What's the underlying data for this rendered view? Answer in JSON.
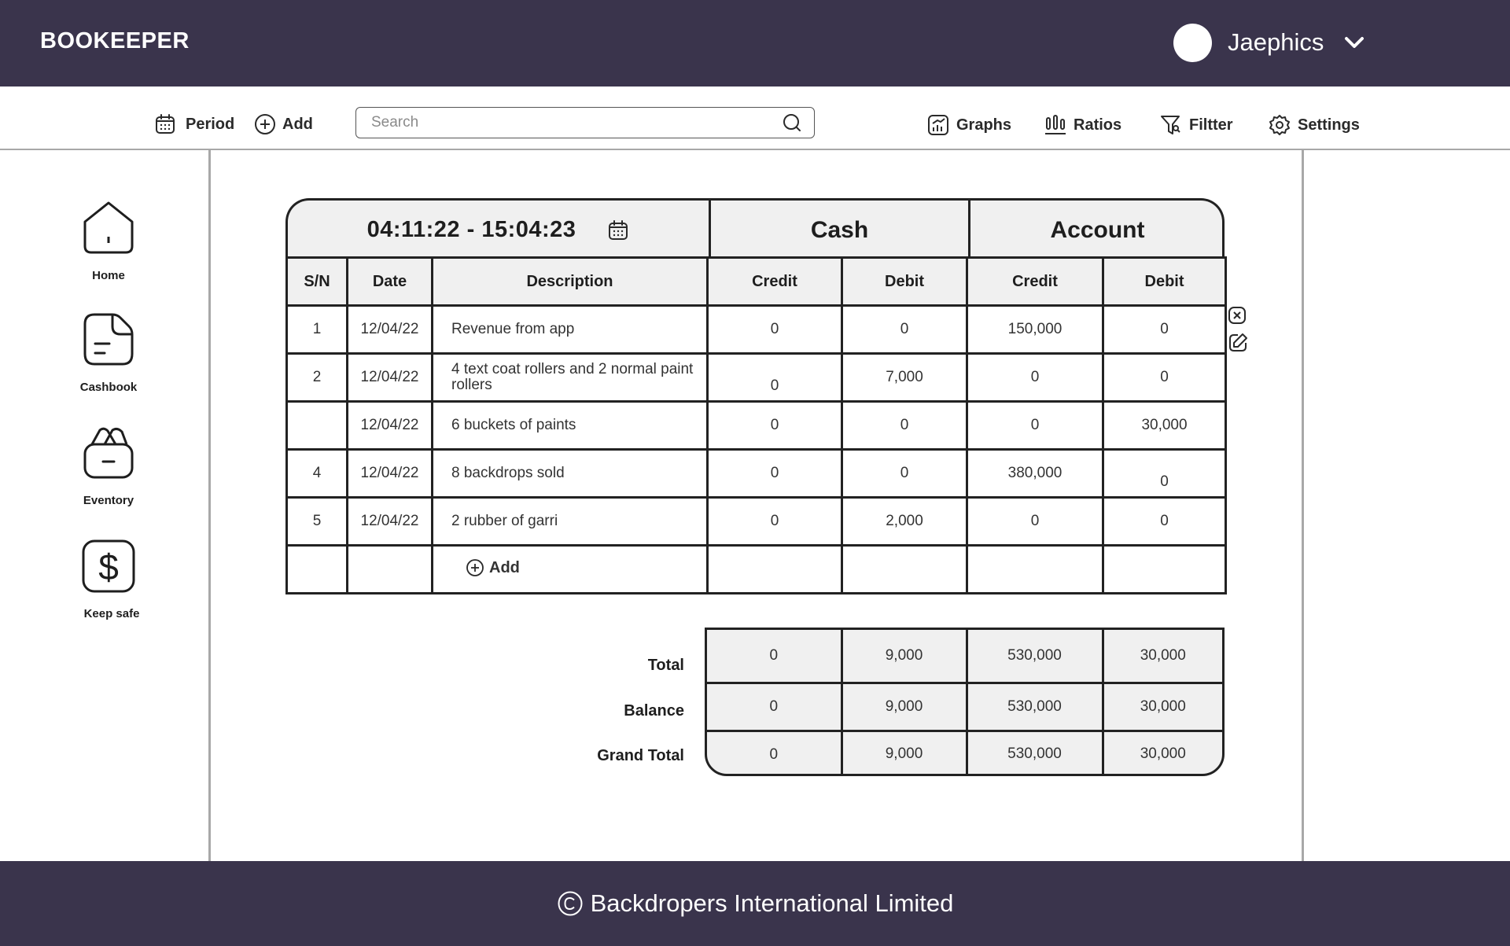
{
  "app": {
    "brand": "BOOKEEPER"
  },
  "user": {
    "name": "Jaephics"
  },
  "toolbar": {
    "period": "Period",
    "add": "Add",
    "search_placeholder": "Search",
    "graphs": "Graphs",
    "ratios": "Ratios",
    "filter": "Filtter",
    "settings": "Settings"
  },
  "sidebar": {
    "items": [
      {
        "label": "Home",
        "icon": "home-icon"
      },
      {
        "label": "Cashbook",
        "icon": "cashbook-icon"
      },
      {
        "label": "Eventory",
        "icon": "inventory-icon"
      },
      {
        "label": "Keep safe",
        "icon": "dollar-icon"
      }
    ]
  },
  "ledger": {
    "period": "04:11:22 - 15:04:23",
    "group_cash": "Cash",
    "group_account": "Account",
    "columns": [
      "S/N",
      "Date",
      "Description",
      "Credit",
      "Debit",
      "Credit",
      "Debit"
    ],
    "rows": [
      [
        "1",
        "12/04/22",
        "Revenue from app",
        "0",
        "0",
        "150,000",
        "0"
      ],
      [
        "2",
        "12/04/22",
        "4 text coat rollers and 2 normal paint rollers",
        "0",
        "7,000",
        "0",
        "0"
      ],
      [
        "",
        "12/04/22",
        "6 buckets of paints",
        "0",
        "0",
        "0",
        "30,000"
      ],
      [
        "4",
        "12/04/22",
        "8 backdrops sold",
        "0",
        "0",
        "380,000",
        "0"
      ],
      [
        "5",
        "12/04/22",
        "2 rubber of garri",
        "0",
        "2,000",
        "0",
        "0"
      ]
    ],
    "add_label": "Add"
  },
  "totals": {
    "labels": [
      "Total",
      "Balance",
      "Grand Total"
    ],
    "rows": [
      [
        "0",
        "9,000",
        "530,000",
        "30,000"
      ],
      [
        "0",
        "9,000",
        "530,000",
        "30,000"
      ],
      [
        "0",
        "9,000",
        "530,000",
        "30,000"
      ]
    ]
  },
  "footer": {
    "text": "Backdropers International Limited"
  },
  "colors": {
    "header_bg": "#3a344c",
    "table_header_bg": "#f0f0f0",
    "border": "#222222"
  }
}
